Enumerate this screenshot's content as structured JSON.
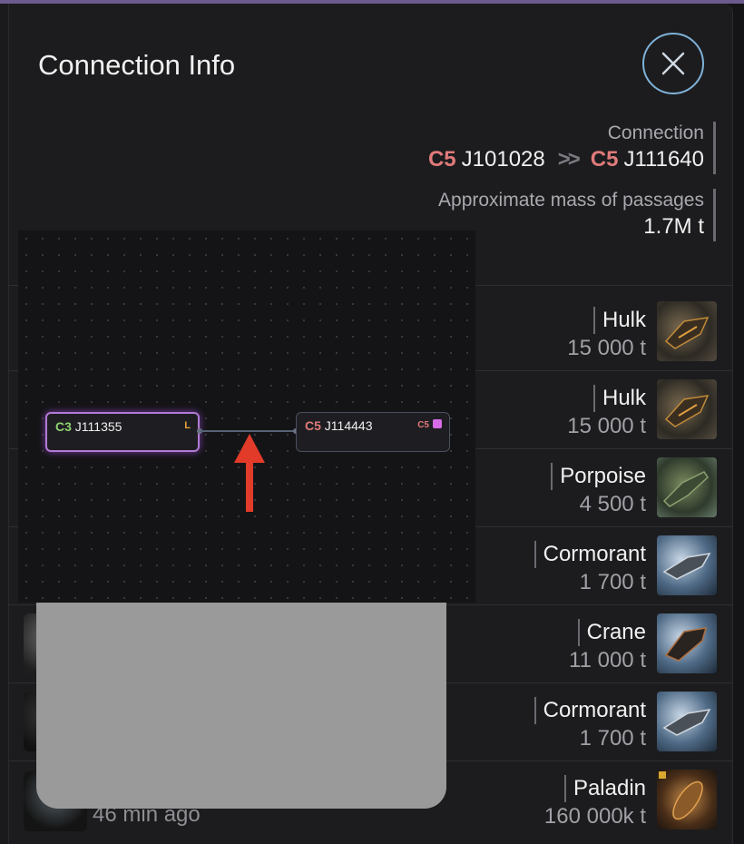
{
  "dialog": {
    "title": "Connection Info",
    "close_label": "×"
  },
  "connection": {
    "label": "Connection",
    "from_class": "C5",
    "from_system": "J101028",
    "arrow": ">>",
    "to_class": "C5",
    "to_system": "J111640"
  },
  "mass": {
    "label": "Approximate mass of passages",
    "value": "1.7M t"
  },
  "ships": [
    {
      "name": "Hulk",
      "mass": "15 000 t",
      "icon": "hulk-ship-icon"
    },
    {
      "name": "Hulk",
      "mass": "15 000 t",
      "icon": "hulk-ship-icon"
    },
    {
      "name": "Porpoise",
      "mass": "4 500 t",
      "icon": "porpoise-ship-icon"
    },
    {
      "name": "Cormorant",
      "mass": "1 700 t",
      "icon": "cormorant-ship-icon"
    },
    {
      "name": "Crane",
      "mass": "11 000 t",
      "icon": "crane-ship-icon"
    },
    {
      "name": "Cormorant",
      "mass": "1 700 t",
      "icon": "cormorant-ship-icon"
    },
    {
      "name": "Paladin",
      "mass": "160 000k t",
      "icon": "paladin-ship-icon"
    }
  ],
  "last_row_time": "46 min ago",
  "map": {
    "node_a": {
      "class": "C3",
      "system": "J111355",
      "tag": "L"
    },
    "node_b": {
      "class": "C5",
      "system": "J114443",
      "tag": "C5"
    }
  },
  "colors": {
    "class_c5": "#e07a7a",
    "class_c3": "#8ed16f",
    "close_ring": "#7fb2d9",
    "arrow_annotation": "#e23b2a",
    "node_highlight": "#b27bd4"
  }
}
